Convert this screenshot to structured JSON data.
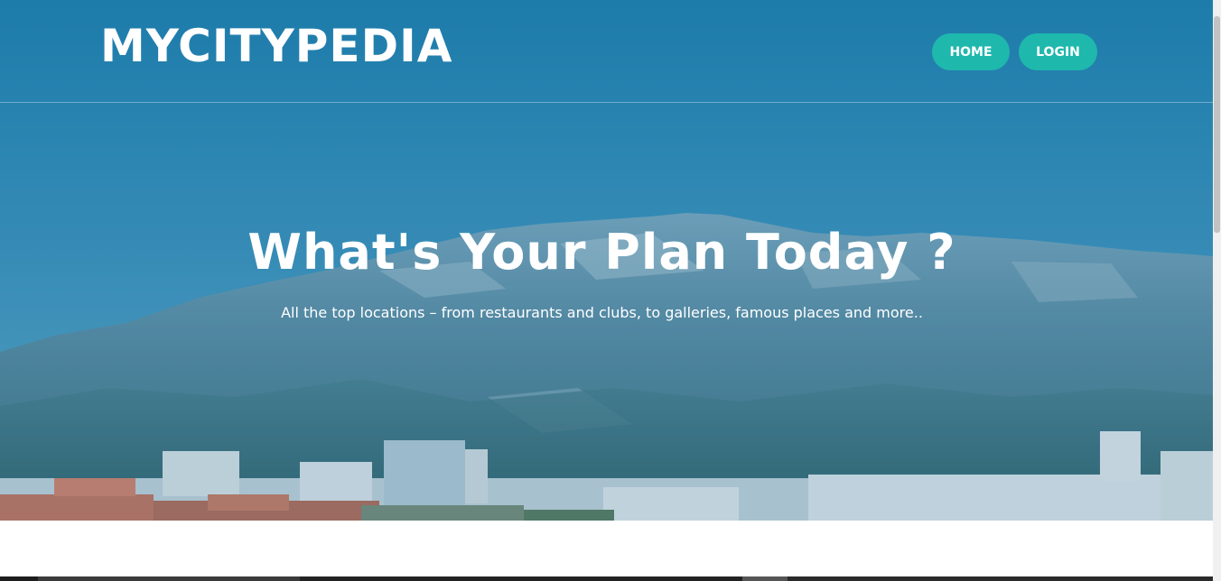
{
  "header": {
    "brand": "MYCITYPEDIA",
    "nav": [
      {
        "label": "HOME"
      },
      {
        "label": "LOGIN"
      }
    ]
  },
  "hero": {
    "title": "What's Your Plan Today ?",
    "subtitle": "All the top locations – from restaurants and clubs, to galleries, famous places and more.."
  },
  "colors": {
    "nav_button": "#1fb8ad",
    "hero_overlay": "#2f8ab4",
    "text": "#ffffff"
  }
}
